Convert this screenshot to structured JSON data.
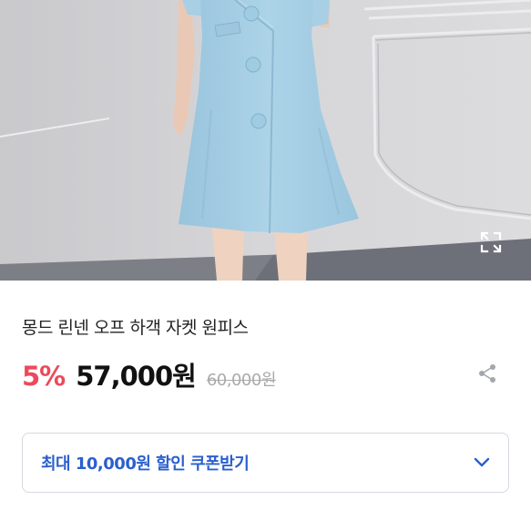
{
  "product": {
    "title": "몽드 린넨 오프 하객 자켓 원피스",
    "discount_rate": "5%",
    "price": "57,000원",
    "original_price": "60,000원"
  },
  "coupon": {
    "label": "최대 10,000원 할인 쿠폰받기"
  },
  "icons": {
    "expand": "expand-icon",
    "share": "share-icon",
    "chevron": "chevron-down-icon"
  },
  "colors": {
    "discount": "#ec4a5b",
    "coupon_text": "#2b5fce",
    "dress": "#a7d0e6"
  }
}
